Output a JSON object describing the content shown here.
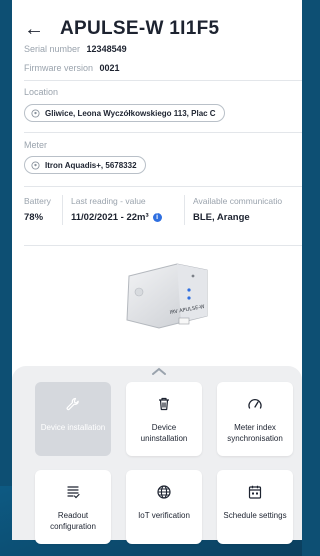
{
  "header": {
    "title": "APULSE-W 1I1F5"
  },
  "serial": {
    "label": "Serial number",
    "value": "12348549"
  },
  "firmware": {
    "label": "Firmware version",
    "value": "0021"
  },
  "location": {
    "label": "Location",
    "value": "Gliwice, Leona Wyczółkowskiego 113, Plac C"
  },
  "meter": {
    "label": "Meter",
    "value": "Itron Aquadis+, 5678332"
  },
  "battery": {
    "label": "Battery",
    "value": "78%"
  },
  "last_reading": {
    "label": "Last reading - value",
    "value": "11/02/2021 - 22m³"
  },
  "communication": {
    "label": "Available communicatio",
    "value": "BLE, Arange"
  },
  "device_label": "IRV APULSE-W",
  "actions": [
    {
      "label": "Device installation",
      "icon": "wrench-icon",
      "enabled": false
    },
    {
      "label": "Device uninstallation",
      "icon": "trash-icon",
      "enabled": true
    },
    {
      "label": "Meter index synchronisation",
      "icon": "gauge-icon",
      "enabled": true
    },
    {
      "label": "Readout configuration",
      "icon": "list-check-icon",
      "enabled": true
    },
    {
      "label": "IoT verification",
      "icon": "globe-icon",
      "enabled": true
    },
    {
      "label": "Schedule settings",
      "icon": "calendar-icon",
      "enabled": true
    }
  ],
  "colors": {
    "background": "#0d4f73",
    "accent": "#2f6fe0",
    "disabled_tile": "#d5d8dd"
  }
}
